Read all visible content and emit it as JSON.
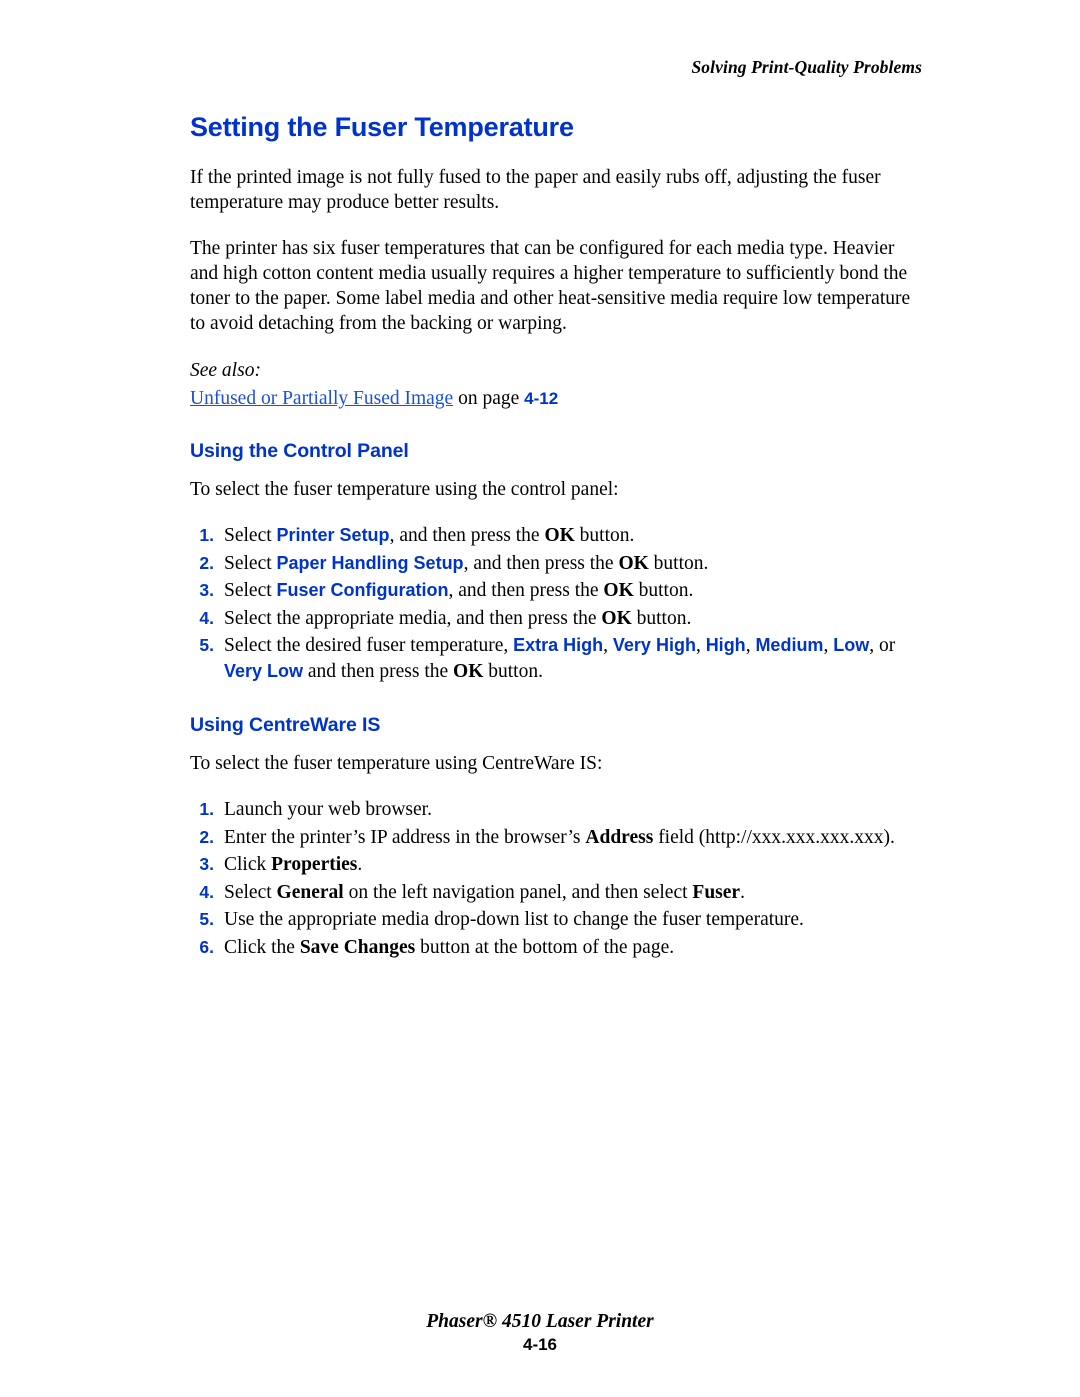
{
  "header": {
    "running_head": "Solving Print-Quality Problems"
  },
  "main": {
    "title": "Setting the Fuser Temperature",
    "intro_paragraphs": [
      "If the printed image is not fully fused to the paper and easily rubs off, adjusting the fuser temperature may produce better results.",
      "The printer has six fuser temperatures that can be configured for each media type. Heavier and high cotton content media usually requires a higher temperature to sufficiently bond the toner to the paper. Some label media and other heat-sensitive media require low temperature to avoid detaching from the backing or warping."
    ],
    "see_also_label": "See also:",
    "see_also_link": "Unfused or Partially Fused Image",
    "see_also_tail": " on page ",
    "see_also_page": "4-12",
    "section_control_panel": {
      "heading": "Using the Control Panel",
      "lead_in": "To select the fuser temperature using the control panel:",
      "steps": [
        {
          "num": "1.",
          "parts": [
            {
              "text": "Select ",
              "style": "plain"
            },
            {
              "text": "Printer Setup",
              "style": "cmd"
            },
            {
              "text": ", and then press the ",
              "style": "plain"
            },
            {
              "text": "OK",
              "style": "bold"
            },
            {
              "text": " button.",
              "style": "plain"
            }
          ]
        },
        {
          "num": "2.",
          "parts": [
            {
              "text": "Select ",
              "style": "plain"
            },
            {
              "text": "Paper Handling Setup",
              "style": "cmd"
            },
            {
              "text": ", and then press the ",
              "style": "plain"
            },
            {
              "text": "OK",
              "style": "bold"
            },
            {
              "text": " button.",
              "style": "plain"
            }
          ]
        },
        {
          "num": "3.",
          "parts": [
            {
              "text": "Select ",
              "style": "plain"
            },
            {
              "text": "Fuser Configuration",
              "style": "cmd"
            },
            {
              "text": ", and then press the ",
              "style": "plain"
            },
            {
              "text": "OK",
              "style": "bold"
            },
            {
              "text": " button.",
              "style": "plain"
            }
          ]
        },
        {
          "num": "4.",
          "parts": [
            {
              "text": "Select the appropriate media, and then press the ",
              "style": "plain"
            },
            {
              "text": "OK",
              "style": "bold"
            },
            {
              "text": " button.",
              "style": "plain"
            }
          ]
        },
        {
          "num": "5.",
          "parts": [
            {
              "text": "Select the desired fuser temperature, ",
              "style": "plain"
            },
            {
              "text": "Extra High",
              "style": "cmd"
            },
            {
              "text": ", ",
              "style": "plain"
            },
            {
              "text": "Very High",
              "style": "cmd"
            },
            {
              "text": ", ",
              "style": "plain"
            },
            {
              "text": "High",
              "style": "cmd"
            },
            {
              "text": ", ",
              "style": "plain"
            },
            {
              "text": "Medium",
              "style": "cmd"
            },
            {
              "text": ", ",
              "style": "plain"
            },
            {
              "text": "Low",
              "style": "cmd"
            },
            {
              "text": ", or ",
              "style": "plain"
            },
            {
              "text": "Very Low",
              "style": "cmd"
            },
            {
              "text": " and then press the ",
              "style": "plain"
            },
            {
              "text": "OK",
              "style": "bold"
            },
            {
              "text": " button.",
              "style": "plain"
            }
          ]
        }
      ]
    },
    "section_centreware": {
      "heading": "Using CentreWare IS",
      "lead_in": "To select the fuser temperature using CentreWare IS:",
      "steps": [
        {
          "num": "1.",
          "parts": [
            {
              "text": "Launch your web browser.",
              "style": "plain"
            }
          ]
        },
        {
          "num": "2.",
          "parts": [
            {
              "text": "Enter the printer’s IP address in the browser’s ",
              "style": "plain"
            },
            {
              "text": "Address",
              "style": "bold"
            },
            {
              "text": " field (http://xxx.xxx.xxx.xxx).",
              "style": "plain"
            }
          ]
        },
        {
          "num": "3.",
          "parts": [
            {
              "text": "Click ",
              "style": "plain"
            },
            {
              "text": "Properties",
              "style": "bold"
            },
            {
              "text": ".",
              "style": "plain"
            }
          ]
        },
        {
          "num": "4.",
          "parts": [
            {
              "text": "Select ",
              "style": "plain"
            },
            {
              "text": "General",
              "style": "bold"
            },
            {
              "text": " on the left navigation panel, and then select ",
              "style": "plain"
            },
            {
              "text": "Fuser",
              "style": "bold"
            },
            {
              "text": ".",
              "style": "plain"
            }
          ]
        },
        {
          "num": "5.",
          "parts": [
            {
              "text": "Use the appropriate media drop-down list to change the fuser temperature.",
              "style": "plain"
            }
          ]
        },
        {
          "num": "6.",
          "parts": [
            {
              "text": "Click the ",
              "style": "plain"
            },
            {
              "text": "Save Changes",
              "style": "bold"
            },
            {
              "text": " button at the bottom of the page.",
              "style": "plain"
            }
          ]
        }
      ]
    }
  },
  "footer": {
    "product": "Phaser® 4510 Laser Printer",
    "page_number": "4-16"
  },
  "colors": {
    "accent_blue": "#0033cc",
    "link_blue": "#1a4fd6",
    "text": "#000000",
    "background": "#ffffff"
  }
}
